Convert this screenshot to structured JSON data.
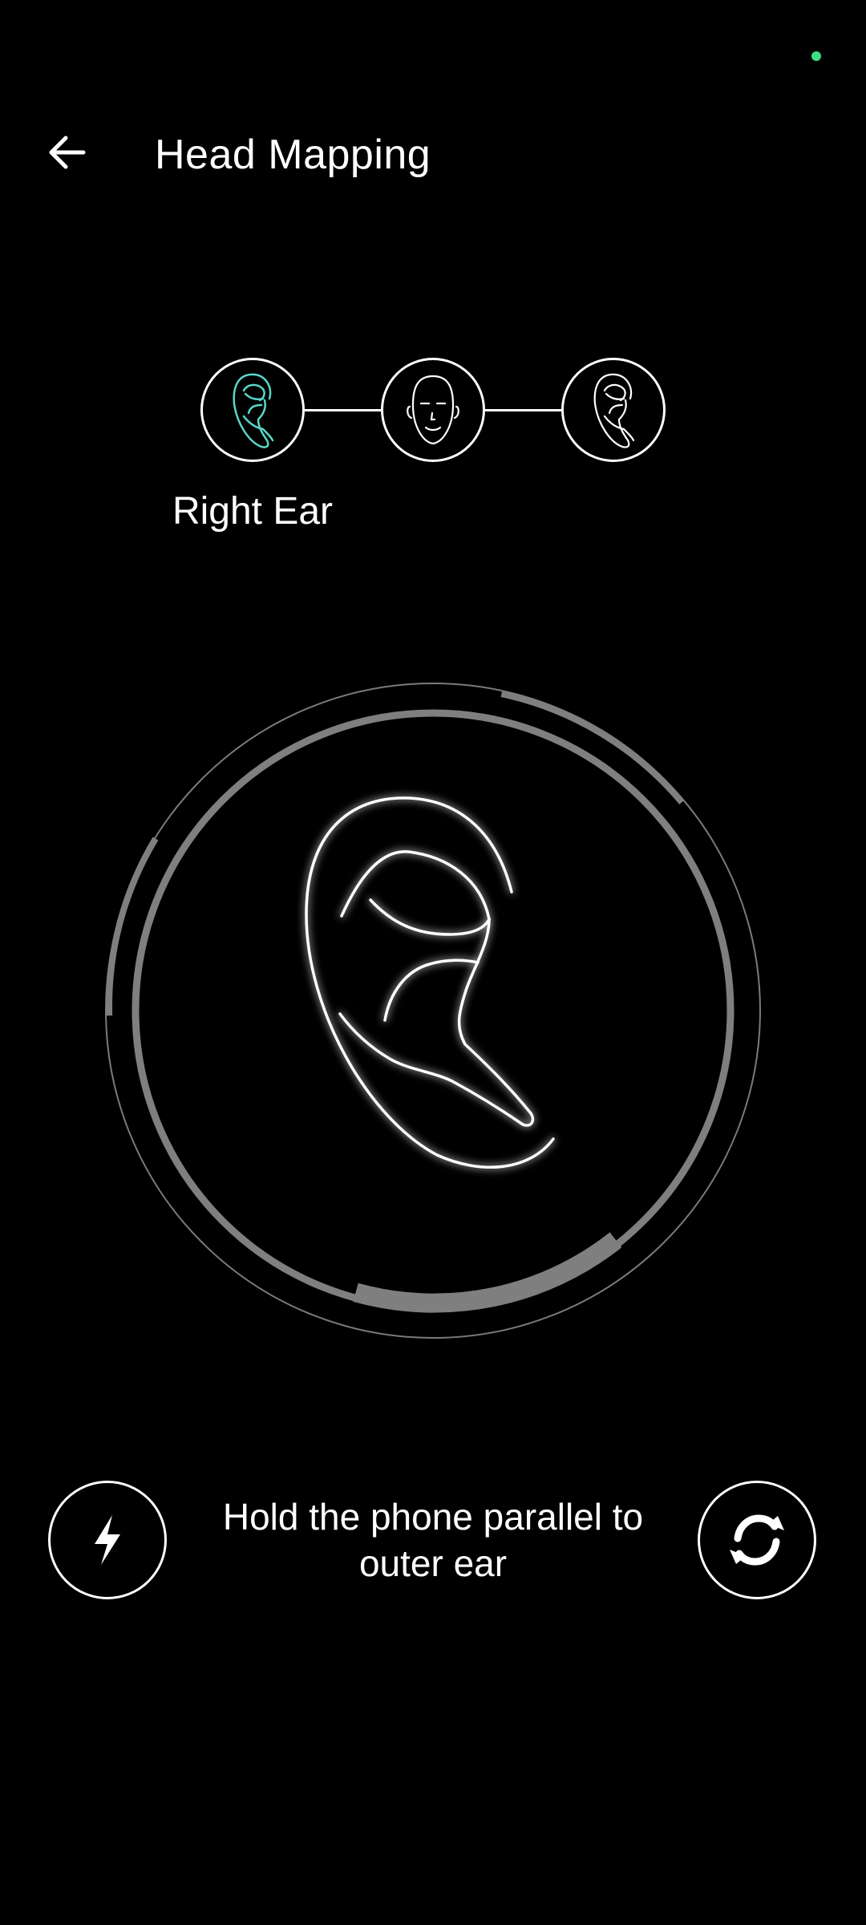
{
  "header": {
    "title": "Head Mapping",
    "back_icon": "arrow-left-icon"
  },
  "steps": {
    "items": [
      {
        "icon": "right-ear-icon",
        "state": "active"
      },
      {
        "icon": "face-icon",
        "state": "pending"
      },
      {
        "icon": "left-ear-icon",
        "state": "pending"
      }
    ],
    "current_label": "Right Ear"
  },
  "scanner": {
    "icon": "ear-outline-icon"
  },
  "footer": {
    "instruction": "Hold the phone parallel to outer ear",
    "flash_icon": "flash-icon",
    "switch_camera_icon": "switch-camera-icon"
  },
  "colors": {
    "background": "#000000",
    "accent": "#5ad6c8",
    "status_dot": "#3ddc84",
    "ring": "#808080"
  }
}
